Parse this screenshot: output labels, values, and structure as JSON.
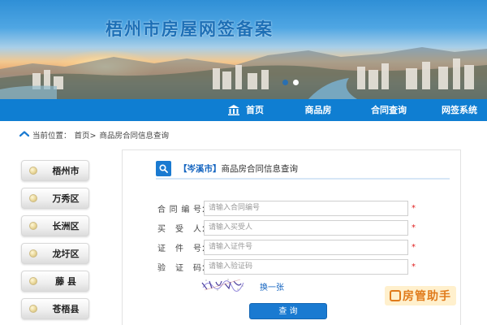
{
  "banner": {
    "title": "梧州市房屋网签备案",
    "slides": 2,
    "active_slide": 2
  },
  "nav": {
    "home": "首页",
    "items": [
      "商品房",
      "合同查询",
      "网签系统"
    ]
  },
  "breadcrumb": {
    "prefix": "当前位置：",
    "home": "首页>",
    "current": "商品房合同信息查询"
  },
  "sidebar": {
    "items": [
      {
        "label": "梧州市"
      },
      {
        "label": "万秀区"
      },
      {
        "label": "长洲区"
      },
      {
        "label": "龙圩区"
      },
      {
        "label": "藤 县"
      },
      {
        "label": "苍梧县"
      }
    ]
  },
  "panel": {
    "city": "【岑溪市】",
    "title": "商品房合同信息查询"
  },
  "form": {
    "fields": [
      {
        "label": "合同编号",
        "placeholder": "请输入合同编号",
        "required": "*"
      },
      {
        "label": "买 受 人",
        "placeholder": "请输入买受人",
        "required": "*"
      },
      {
        "label": "证 件 号",
        "placeholder": "请输入证件号",
        "required": "*"
      },
      {
        "label": "验 证 码",
        "placeholder": "请输入验证码",
        "required": "*"
      }
    ],
    "colon": "：",
    "refresh_captcha": "换一张",
    "submit": "查 询"
  },
  "watermark": {
    "text": "房管助手"
  },
  "colors": {
    "primary": "#0f7ed2",
    "required": "#e02020",
    "watermark": "#e07b1b"
  }
}
